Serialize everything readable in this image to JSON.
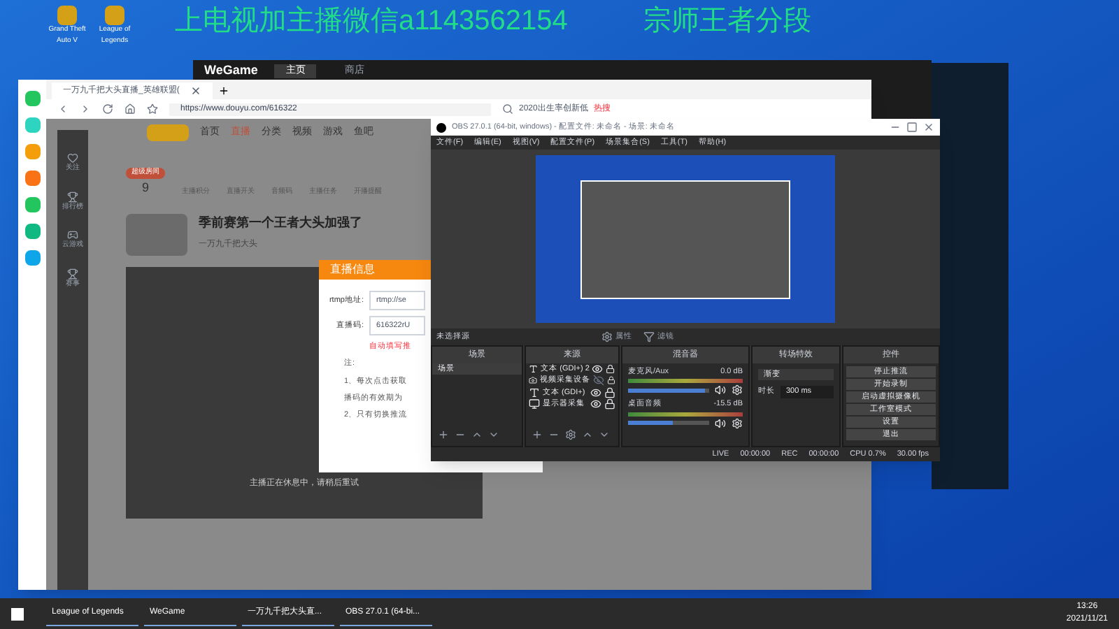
{
  "desktop": {
    "overlay_texts": [
      "上电视加主播微信a1143562154",
      "宗师王者分段"
    ],
    "icons": [
      {
        "label": "Grand Theft Auto V"
      },
      {
        "label": "League of Legends"
      }
    ]
  },
  "wegame": {
    "title": "WeGame",
    "tabs": [
      {
        "label": "主页",
        "selected": true
      },
      {
        "label": "商店",
        "selected": false
      }
    ]
  },
  "browser": {
    "tab": "一万九千把大头直播_英雄联盟(",
    "address": "https://www.douyu.com/616322",
    "search": "2020出生率创新低",
    "hot": "热搜"
  },
  "douyu": {
    "nav": [
      {
        "label": "首页",
        "selected": false
      },
      {
        "label": "直播",
        "selected": true
      },
      {
        "label": "分类",
        "selected": false
      },
      {
        "label": "视频",
        "selected": false
      },
      {
        "label": "游戏",
        "selected": false
      },
      {
        "label": "鱼吧",
        "selected": false
      }
    ],
    "sidebar": [
      "关注",
      "排行榜",
      "云游戏",
      "赛事"
    ],
    "badge": "超级房间",
    "score": "9",
    "tools": [
      "主播积分",
      "直播开关",
      "音频码",
      "主播任务",
      "开播提醒"
    ],
    "title": "季前赛第一个王者大头加强了",
    "streamer": "一万九千把大头",
    "stream_message": "主播正在休息中，请稍后重试"
  },
  "dialog": {
    "title": "直播信息",
    "fields": [
      {
        "label": "rtmp地址:",
        "value": "rtmp://se"
      },
      {
        "label": "直播码:",
        "value": "616322rU"
      }
    ],
    "warning": "自动填写推",
    "notes": [
      "注:",
      "1、每次点击获取",
      "播码的有效期为",
      "2、只有切换推流"
    ]
  },
  "obs": {
    "title": "OBS 27.0.1 (64-bit, windows) - 配置文件: 未命名 - 场景: 未命名",
    "menu": [
      "文件(F)",
      "编辑(E)",
      "视图(V)",
      "配置文件(P)",
      "场景集合(S)",
      "工具(T)",
      "帮助(H)"
    ],
    "source_bar": {
      "label": "未选择源",
      "buttons": [
        "属性",
        "滤镜"
      ]
    },
    "scenes": {
      "title": "场景",
      "items": [
        {
          "label": "场景",
          "selected": true
        }
      ]
    },
    "sources": {
      "title": "来源",
      "items": [
        {
          "kind": "text",
          "label": "文本 (GDI+) 2",
          "visible": true
        },
        {
          "kind": "camera",
          "label": "视频采集设备",
          "visible": false
        },
        {
          "kind": "text",
          "label": "文本 (GDI+)",
          "visible": true
        },
        {
          "kind": "monitor",
          "label": "显示器采集",
          "visible": true
        }
      ]
    },
    "mixer": {
      "title": "混音器",
      "channels": [
        {
          "name": "麦克风/Aux",
          "reading": "0.0 dB",
          "level": 0.95
        },
        {
          "name": "桌面音频",
          "reading": "-15.5 dB",
          "level": 0.55
        }
      ]
    },
    "transitions": {
      "title": "转场特效",
      "type": "渐变",
      "duration_label": "时长",
      "duration": "300 ms"
    },
    "controls": {
      "title": "控件",
      "buttons": [
        "停止推流",
        "开始录制",
        "启动虚拟摄像机",
        "工作室模式",
        "设置",
        "退出"
      ]
    },
    "status": {
      "live": "LIVE",
      "live_time": "00:00:00",
      "rec": "REC",
      "rec_time": "00:00:00",
      "cpu": "CPU 0.7%",
      "fps": "30.00 fps"
    }
  },
  "taskbar": {
    "apps": [
      {
        "label": "League of Legends"
      },
      {
        "label": "WeGame"
      },
      {
        "label": "一万九千把大头直..."
      },
      {
        "label": "OBS 27.0.1 (64-bi..."
      }
    ],
    "time": "13:26",
    "date": "2021/11/21"
  }
}
